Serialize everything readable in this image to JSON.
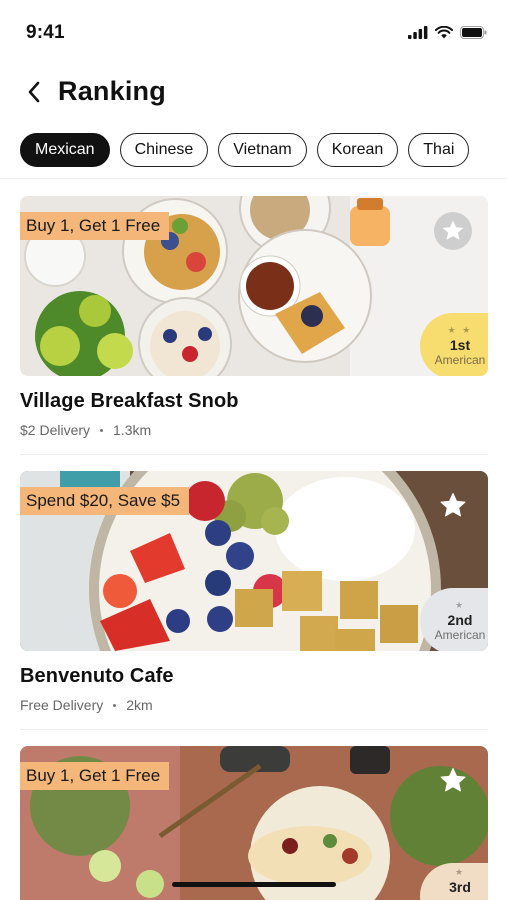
{
  "status": {
    "time": "9:41"
  },
  "header": {
    "title": "Ranking",
    "back_icon": "chevron-left-icon"
  },
  "tabs": [
    {
      "label": "Mexican",
      "active": true
    },
    {
      "label": "Chinese",
      "active": false
    },
    {
      "label": "Vietnam",
      "active": false
    },
    {
      "label": "Korean",
      "active": false
    },
    {
      "label": "Thai",
      "active": false
    }
  ],
  "restaurants": [
    {
      "name": "Village Breakfast Snob",
      "promo": "Buy 1, Get 1 Free",
      "delivery": "$2 Delivery",
      "distance": "1.3km",
      "rank": "1st",
      "rank_category": "American",
      "badge_color": "#f7dc6f",
      "favorite": false
    },
    {
      "name": "Benvenuto Cafe",
      "promo": "Spend $20, Save $5",
      "delivery": "Free Delivery",
      "distance": "2km",
      "rank": "2nd",
      "rank_category": "American",
      "badge_color": "#e4e6ea",
      "favorite": false
    },
    {
      "name": "",
      "promo": "Buy 1, Get 1 Free",
      "delivery": "",
      "distance": "",
      "rank": "3rd",
      "rank_category": "",
      "badge_color": "#f1dcc6",
      "favorite": false
    }
  ],
  "colors": {
    "accent": "#111111",
    "promo": "#f4b679"
  }
}
